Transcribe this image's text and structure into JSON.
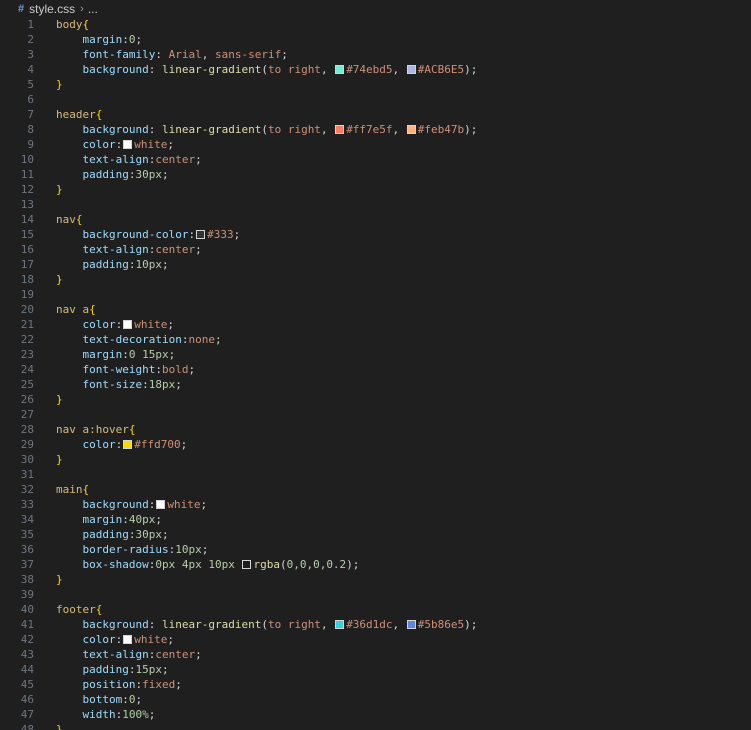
{
  "breadcrumb": {
    "file": "style.css",
    "rest": "..."
  },
  "lines": [
    {
      "n": "1",
      "tokens": [
        {
          "t": "body",
          "c": "sel"
        },
        {
          "t": "{",
          "c": "brace"
        }
      ]
    },
    {
      "n": "2",
      "tokens": [
        {
          "t": "    "
        },
        {
          "t": "margin",
          "c": "prop"
        },
        {
          "t": ":"
        },
        {
          "t": "0",
          "c": "num"
        },
        {
          "t": ";"
        }
      ]
    },
    {
      "n": "3",
      "tokens": [
        {
          "t": "    "
        },
        {
          "t": "font-family",
          "c": "prop"
        },
        {
          "t": ": "
        },
        {
          "t": "Arial",
          "c": "val"
        },
        {
          "t": ", "
        },
        {
          "t": "sans-serif",
          "c": "val"
        },
        {
          "t": ";"
        }
      ]
    },
    {
      "n": "4",
      "tokens": [
        {
          "t": "    "
        },
        {
          "t": "background",
          "c": "prop"
        },
        {
          "t": ": "
        },
        {
          "t": "linear-gradient",
          "c": "fn"
        },
        {
          "t": "("
        },
        {
          "t": "to right",
          "c": "val"
        },
        {
          "t": ", "
        },
        {
          "sw": "#74ebd5"
        },
        {
          "t": "#74ebd5",
          "c": "val"
        },
        {
          "t": ", "
        },
        {
          "sw": "#ACB6E5"
        },
        {
          "t": "#ACB6E5",
          "c": "val"
        },
        {
          "t": ");"
        }
      ]
    },
    {
      "n": "5",
      "tokens": [
        {
          "t": "}",
          "c": "brace"
        }
      ]
    },
    {
      "n": "6",
      "tokens": []
    },
    {
      "n": "7",
      "tokens": [
        {
          "t": "header",
          "c": "sel"
        },
        {
          "t": "{",
          "c": "brace"
        }
      ]
    },
    {
      "n": "8",
      "tokens": [
        {
          "t": "    "
        },
        {
          "t": "background",
          "c": "prop"
        },
        {
          "t": ": "
        },
        {
          "t": "linear-gradient",
          "c": "fn"
        },
        {
          "t": "("
        },
        {
          "t": "to right",
          "c": "val"
        },
        {
          "t": ", "
        },
        {
          "sw": "#ff7e5f"
        },
        {
          "t": "#ff7e5f",
          "c": "val"
        },
        {
          "t": ", "
        },
        {
          "sw": "#feb47b"
        },
        {
          "t": "#feb47b",
          "c": "val"
        },
        {
          "t": ");"
        }
      ]
    },
    {
      "n": "9",
      "tokens": [
        {
          "t": "    "
        },
        {
          "t": "color",
          "c": "prop"
        },
        {
          "t": ":"
        },
        {
          "sw": "#ffffff"
        },
        {
          "t": "white",
          "c": "val"
        },
        {
          "t": ";"
        }
      ]
    },
    {
      "n": "10",
      "tokens": [
        {
          "t": "    "
        },
        {
          "t": "text-align",
          "c": "prop"
        },
        {
          "t": ":"
        },
        {
          "t": "center",
          "c": "val"
        },
        {
          "t": ";"
        }
      ]
    },
    {
      "n": "11",
      "tokens": [
        {
          "t": "    "
        },
        {
          "t": "padding",
          "c": "prop"
        },
        {
          "t": ":"
        },
        {
          "t": "30px",
          "c": "num"
        },
        {
          "t": ";"
        }
      ]
    },
    {
      "n": "12",
      "tokens": [
        {
          "t": "}",
          "c": "brace"
        }
      ]
    },
    {
      "n": "13",
      "tokens": []
    },
    {
      "n": "14",
      "tokens": [
        {
          "t": "nav",
          "c": "sel"
        },
        {
          "t": "{",
          "c": "brace"
        }
      ]
    },
    {
      "n": "15",
      "tokens": [
        {
          "t": "    "
        },
        {
          "t": "background-color",
          "c": "prop"
        },
        {
          "t": ":"
        },
        {
          "sw": "#333333"
        },
        {
          "t": "#333",
          "c": "val"
        },
        {
          "t": ";"
        }
      ]
    },
    {
      "n": "16",
      "tokens": [
        {
          "t": "    "
        },
        {
          "t": "text-align",
          "c": "prop"
        },
        {
          "t": ":"
        },
        {
          "t": "center",
          "c": "val"
        },
        {
          "t": ";"
        }
      ]
    },
    {
      "n": "17",
      "tokens": [
        {
          "t": "    "
        },
        {
          "t": "padding",
          "c": "prop"
        },
        {
          "t": ":"
        },
        {
          "t": "10px",
          "c": "num"
        },
        {
          "t": ";"
        }
      ]
    },
    {
      "n": "18",
      "tokens": [
        {
          "t": "}",
          "c": "brace"
        }
      ]
    },
    {
      "n": "19",
      "tokens": []
    },
    {
      "n": "20",
      "tokens": [
        {
          "t": "nav a",
          "c": "sel"
        },
        {
          "t": "{",
          "c": "brace"
        }
      ]
    },
    {
      "n": "21",
      "tokens": [
        {
          "t": "    "
        },
        {
          "t": "color",
          "c": "prop"
        },
        {
          "t": ":"
        },
        {
          "sw": "#ffffff"
        },
        {
          "t": "white",
          "c": "val"
        },
        {
          "t": ";"
        }
      ]
    },
    {
      "n": "22",
      "tokens": [
        {
          "t": "    "
        },
        {
          "t": "text-decoration",
          "c": "prop"
        },
        {
          "t": ":"
        },
        {
          "t": "none",
          "c": "val"
        },
        {
          "t": ";"
        }
      ]
    },
    {
      "n": "23",
      "tokens": [
        {
          "t": "    "
        },
        {
          "t": "margin",
          "c": "prop"
        },
        {
          "t": ":"
        },
        {
          "t": "0 15px",
          "c": "num"
        },
        {
          "t": ";"
        }
      ]
    },
    {
      "n": "24",
      "tokens": [
        {
          "t": "    "
        },
        {
          "t": "font-weight",
          "c": "prop"
        },
        {
          "t": ":"
        },
        {
          "t": "bold",
          "c": "val"
        },
        {
          "t": ";"
        }
      ]
    },
    {
      "n": "25",
      "tokens": [
        {
          "t": "    "
        },
        {
          "t": "font-size",
          "c": "prop"
        },
        {
          "t": ":"
        },
        {
          "t": "18px",
          "c": "num"
        },
        {
          "t": ";"
        }
      ]
    },
    {
      "n": "26",
      "tokens": [
        {
          "t": "}",
          "c": "brace"
        }
      ]
    },
    {
      "n": "27",
      "tokens": []
    },
    {
      "n": "28",
      "tokens": [
        {
          "t": "nav a:hover",
          "c": "sel"
        },
        {
          "t": "{",
          "c": "brace"
        }
      ]
    },
    {
      "n": "29",
      "tokens": [
        {
          "t": "    "
        },
        {
          "t": "color",
          "c": "prop"
        },
        {
          "t": ":"
        },
        {
          "sw": "#ffd700"
        },
        {
          "t": "#ffd700",
          "c": "val"
        },
        {
          "t": ";"
        }
      ]
    },
    {
      "n": "30",
      "tokens": [
        {
          "t": "}",
          "c": "brace"
        }
      ]
    },
    {
      "n": "31",
      "tokens": []
    },
    {
      "n": "32",
      "tokens": [
        {
          "t": "main",
          "c": "sel"
        },
        {
          "t": "{",
          "c": "brace"
        }
      ]
    },
    {
      "n": "33",
      "tokens": [
        {
          "t": "    "
        },
        {
          "t": "background",
          "c": "prop"
        },
        {
          "t": ":"
        },
        {
          "sw": "#ffffff"
        },
        {
          "t": "white",
          "c": "val"
        },
        {
          "t": ";"
        }
      ]
    },
    {
      "n": "34",
      "tokens": [
        {
          "t": "    "
        },
        {
          "t": "margin",
          "c": "prop"
        },
        {
          "t": ":"
        },
        {
          "t": "40px",
          "c": "num"
        },
        {
          "t": ";"
        }
      ]
    },
    {
      "n": "35",
      "tokens": [
        {
          "t": "    "
        },
        {
          "t": "padding",
          "c": "prop"
        },
        {
          "t": ":"
        },
        {
          "t": "30px",
          "c": "num"
        },
        {
          "t": ";"
        }
      ]
    },
    {
      "n": "36",
      "tokens": [
        {
          "t": "    "
        },
        {
          "t": "border-radius",
          "c": "prop"
        },
        {
          "t": ":"
        },
        {
          "t": "10px",
          "c": "num"
        },
        {
          "t": ";"
        }
      ]
    },
    {
      "n": "37",
      "tokens": [
        {
          "t": "    "
        },
        {
          "t": "box-shadow",
          "c": "prop"
        },
        {
          "t": ":"
        },
        {
          "t": "0px 4px 10px ",
          "c": "num"
        },
        {
          "sw": "#1f1f1f"
        },
        {
          "t": "rgba",
          "c": "fn"
        },
        {
          "t": "("
        },
        {
          "t": "0,0,0,0.2",
          "c": "num"
        },
        {
          "t": ");"
        }
      ]
    },
    {
      "n": "38",
      "tokens": [
        {
          "t": "}",
          "c": "brace"
        }
      ]
    },
    {
      "n": "39",
      "tokens": []
    },
    {
      "n": "40",
      "tokens": [
        {
          "t": "footer",
          "c": "sel"
        },
        {
          "t": "{",
          "c": "brace"
        }
      ]
    },
    {
      "n": "41",
      "tokens": [
        {
          "t": "    "
        },
        {
          "t": "background",
          "c": "prop"
        },
        {
          "t": ": "
        },
        {
          "t": "linear-gradient",
          "c": "fn"
        },
        {
          "t": "("
        },
        {
          "t": "to right",
          "c": "val"
        },
        {
          "t": ", "
        },
        {
          "sw": "#36d1dc"
        },
        {
          "t": "#36d1dc",
          "c": "val"
        },
        {
          "t": ", "
        },
        {
          "sw": "#5b86e5"
        },
        {
          "t": "#5b86e5",
          "c": "val"
        },
        {
          "t": ");"
        }
      ]
    },
    {
      "n": "42",
      "tokens": [
        {
          "t": "    "
        },
        {
          "t": "color",
          "c": "prop"
        },
        {
          "t": ":"
        },
        {
          "sw": "#ffffff"
        },
        {
          "t": "white",
          "c": "val"
        },
        {
          "t": ";"
        }
      ]
    },
    {
      "n": "43",
      "tokens": [
        {
          "t": "    "
        },
        {
          "t": "text-align",
          "c": "prop"
        },
        {
          "t": ":"
        },
        {
          "t": "center",
          "c": "val"
        },
        {
          "t": ";"
        }
      ]
    },
    {
      "n": "44",
      "tokens": [
        {
          "t": "    "
        },
        {
          "t": "padding",
          "c": "prop"
        },
        {
          "t": ":"
        },
        {
          "t": "15px",
          "c": "num"
        },
        {
          "t": ";"
        }
      ]
    },
    {
      "n": "45",
      "tokens": [
        {
          "t": "    "
        },
        {
          "t": "position",
          "c": "prop"
        },
        {
          "t": ":"
        },
        {
          "t": "fixed",
          "c": "val"
        },
        {
          "t": ";"
        }
      ]
    },
    {
      "n": "46",
      "tokens": [
        {
          "t": "    "
        },
        {
          "t": "bottom",
          "c": "prop"
        },
        {
          "t": ":"
        },
        {
          "t": "0",
          "c": "num"
        },
        {
          "t": ";"
        }
      ]
    },
    {
      "n": "47",
      "tokens": [
        {
          "t": "    "
        },
        {
          "t": "width",
          "c": "prop"
        },
        {
          "t": ":"
        },
        {
          "t": "100%",
          "c": "num"
        },
        {
          "t": ";"
        }
      ]
    },
    {
      "n": "48",
      "tokens": [
        {
          "t": "}",
          "c": "brace"
        }
      ]
    }
  ]
}
